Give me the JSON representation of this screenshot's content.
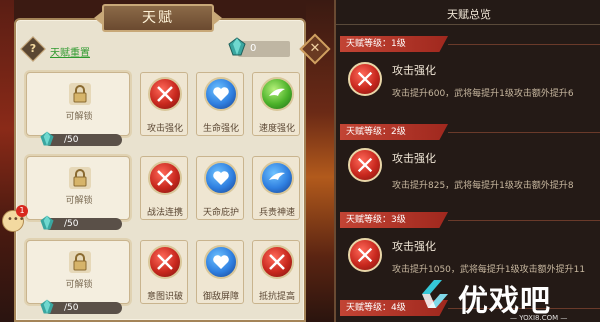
{
  "left_panel": {
    "title": "天赋",
    "help_label": "?",
    "reset_label": "天赋重置",
    "gem_count": "0",
    "close_label": "✕",
    "rows": [
      {
        "unlock_text": "可解锁",
        "cost": "/50",
        "skills": [
          {
            "label": "攻击强化",
            "icon": "swords-icon",
            "color": "red"
          },
          {
            "label": "生命强化",
            "icon": "heart-icon",
            "color": "blue"
          },
          {
            "label": "速度强化",
            "icon": "wing-icon",
            "color": "green"
          }
        ]
      },
      {
        "unlock_text": "可解锁",
        "cost": "/50",
        "skills": [
          {
            "label": "战法连携",
            "icon": "swords-icon",
            "color": "red"
          },
          {
            "label": "天命庇护",
            "icon": "heart-icon",
            "color": "blue"
          },
          {
            "label": "兵贵神速",
            "icon": "wing-icon",
            "color": "blue"
          }
        ]
      },
      {
        "unlock_text": "可解锁",
        "cost": "/50",
        "skills": [
          {
            "label": "意图识破",
            "icon": "swords-icon",
            "color": "red"
          },
          {
            "label": "御敌屏障",
            "icon": "heart-icon",
            "color": "blue"
          },
          {
            "label": "抵抗提高",
            "icon": "swords-icon",
            "color": "red"
          }
        ]
      }
    ]
  },
  "chat": {
    "badge": "1"
  },
  "overview": {
    "title": "天赋总览",
    "tiers": [
      {
        "level": "天赋等级：1级",
        "name": "攻击强化",
        "desc": "攻击提升600，武将每提升1级攻击额外提升6"
      },
      {
        "level": "天赋等级：2级",
        "name": "攻击强化",
        "desc": "攻击提升825，武将每提升1级攻击额外提升8"
      },
      {
        "level": "天赋等级：3级",
        "name": "攻击强化",
        "desc": "攻击提升1050，武将每提升1级攻击额外提升11"
      },
      {
        "level": "天赋等级：4级",
        "name": "",
        "desc": ""
      }
    ]
  },
  "watermark": {
    "text": "优戏吧",
    "url": "— YOXI8.COM —"
  },
  "colors": {
    "accent_red": "#c24434",
    "panel_bg": "#e9e2cf",
    "overview_bg": "#241a16"
  }
}
